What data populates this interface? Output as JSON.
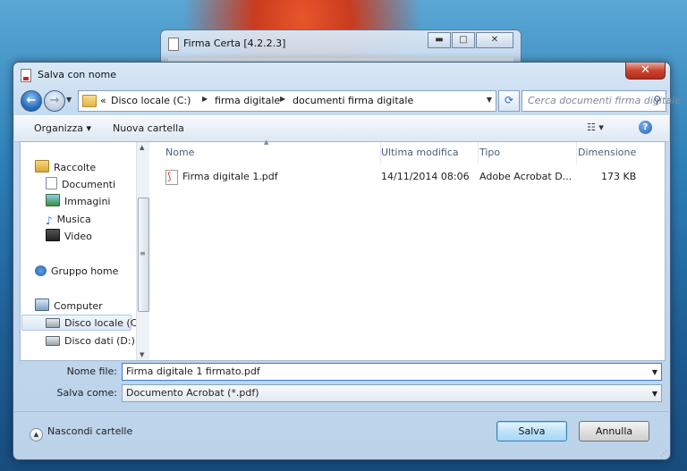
{
  "background_window": {
    "title": "Firma Certa [4.2.2.3]",
    "minimize": "▬",
    "maximize": "□",
    "close": "✕"
  },
  "dialog": {
    "title": "Salva con nome",
    "close": "✕"
  },
  "address": {
    "root_marker": "«",
    "crumbs": [
      "Disco locale (C:)",
      "firma digitale",
      "documenti firma digitale"
    ]
  },
  "search": {
    "placeholder": "Cerca documenti firma digitale"
  },
  "toolbar": {
    "organize": "Organizza ▾",
    "new_folder": "Nuova cartella",
    "view": "☷ ▾",
    "help": "?"
  },
  "nav": {
    "items": [
      {
        "label": "Raccolte",
        "icon": "library-icon"
      },
      {
        "label": "Documenti",
        "icon": "documents-icon"
      },
      {
        "label": "Immagini",
        "icon": "pictures-icon"
      },
      {
        "label": "Musica",
        "icon": "music-icon"
      },
      {
        "label": "Video",
        "icon": "video-icon"
      },
      {
        "label": "Gruppo home",
        "icon": "homegroup-icon"
      },
      {
        "label": "Computer",
        "icon": "computer-icon"
      },
      {
        "label": "Disco locale (C:)",
        "icon": "drive-icon",
        "selected": true
      },
      {
        "label": "Disco dati (D:)",
        "icon": "drive-icon"
      }
    ]
  },
  "columns": [
    "Nome",
    "Ultima modifica",
    "Tipo",
    "Dimensione"
  ],
  "files": [
    {
      "name": "Firma digitale 1.pdf",
      "modified": "14/11/2014 08:06",
      "type": "Adobe Acrobat D...",
      "size": "173 KB",
      "icon": "pdf-icon"
    }
  ],
  "fields": {
    "filename_label": "Nome file:",
    "filename_value": "Firma digitale 1 firmato.pdf",
    "filetype_label": "Salva come:",
    "filetype_value": "Documento Acrobat (*.pdf)"
  },
  "footer": {
    "hide_folders": "Nascondi cartelle",
    "save": "Salva",
    "cancel": "Annulla"
  },
  "colors": {
    "accent": "#3a7bd5",
    "close_button": "#c8452e"
  }
}
